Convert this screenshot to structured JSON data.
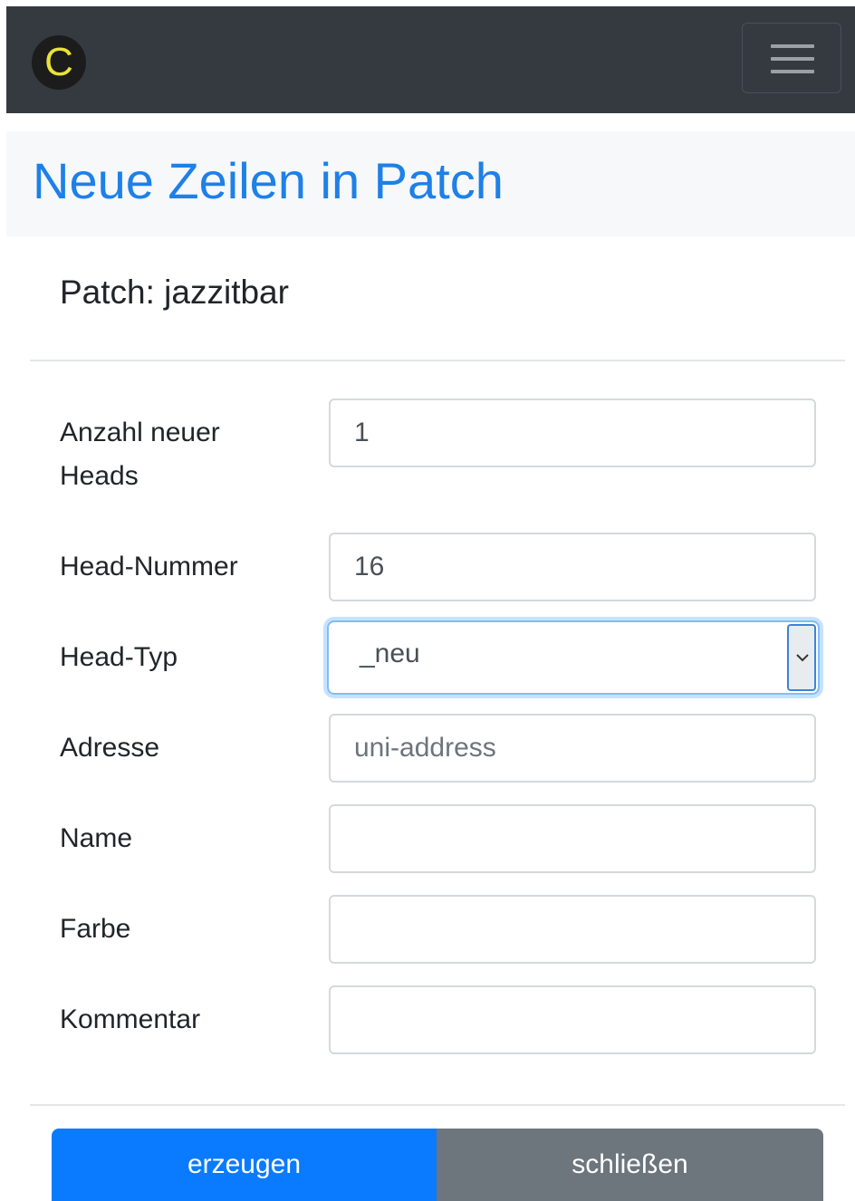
{
  "brand": {
    "logo_letter": "C",
    "logo_color": "#e8e337"
  },
  "navbar": {
    "background": "#343a40",
    "toggler_icon": "hamburger-menu-icon"
  },
  "header": {
    "title": "Neue Zeilen in Patch",
    "title_color": "#1e80e8"
  },
  "form": {
    "patch_label": "Patch: jazzitbar",
    "fields": {
      "anzahl": {
        "label": "Anzahl neuer Heads",
        "value": "1"
      },
      "head_nummer": {
        "label": "Head-Nummer",
        "value": "16"
      },
      "head_typ": {
        "label": "Head-Typ",
        "selected": "_neu"
      },
      "adresse": {
        "label": "Adresse",
        "value": "",
        "placeholder": "uni-address"
      },
      "name": {
        "label": "Name",
        "value": ""
      },
      "farbe": {
        "label": "Farbe",
        "value": ""
      },
      "kommentar": {
        "label": "Kommentar",
        "value": ""
      }
    }
  },
  "actions": {
    "create_label": "erzeugen",
    "close_label": "schließen",
    "primary_color": "#0a7bff",
    "secondary_color": "#6d757d"
  }
}
